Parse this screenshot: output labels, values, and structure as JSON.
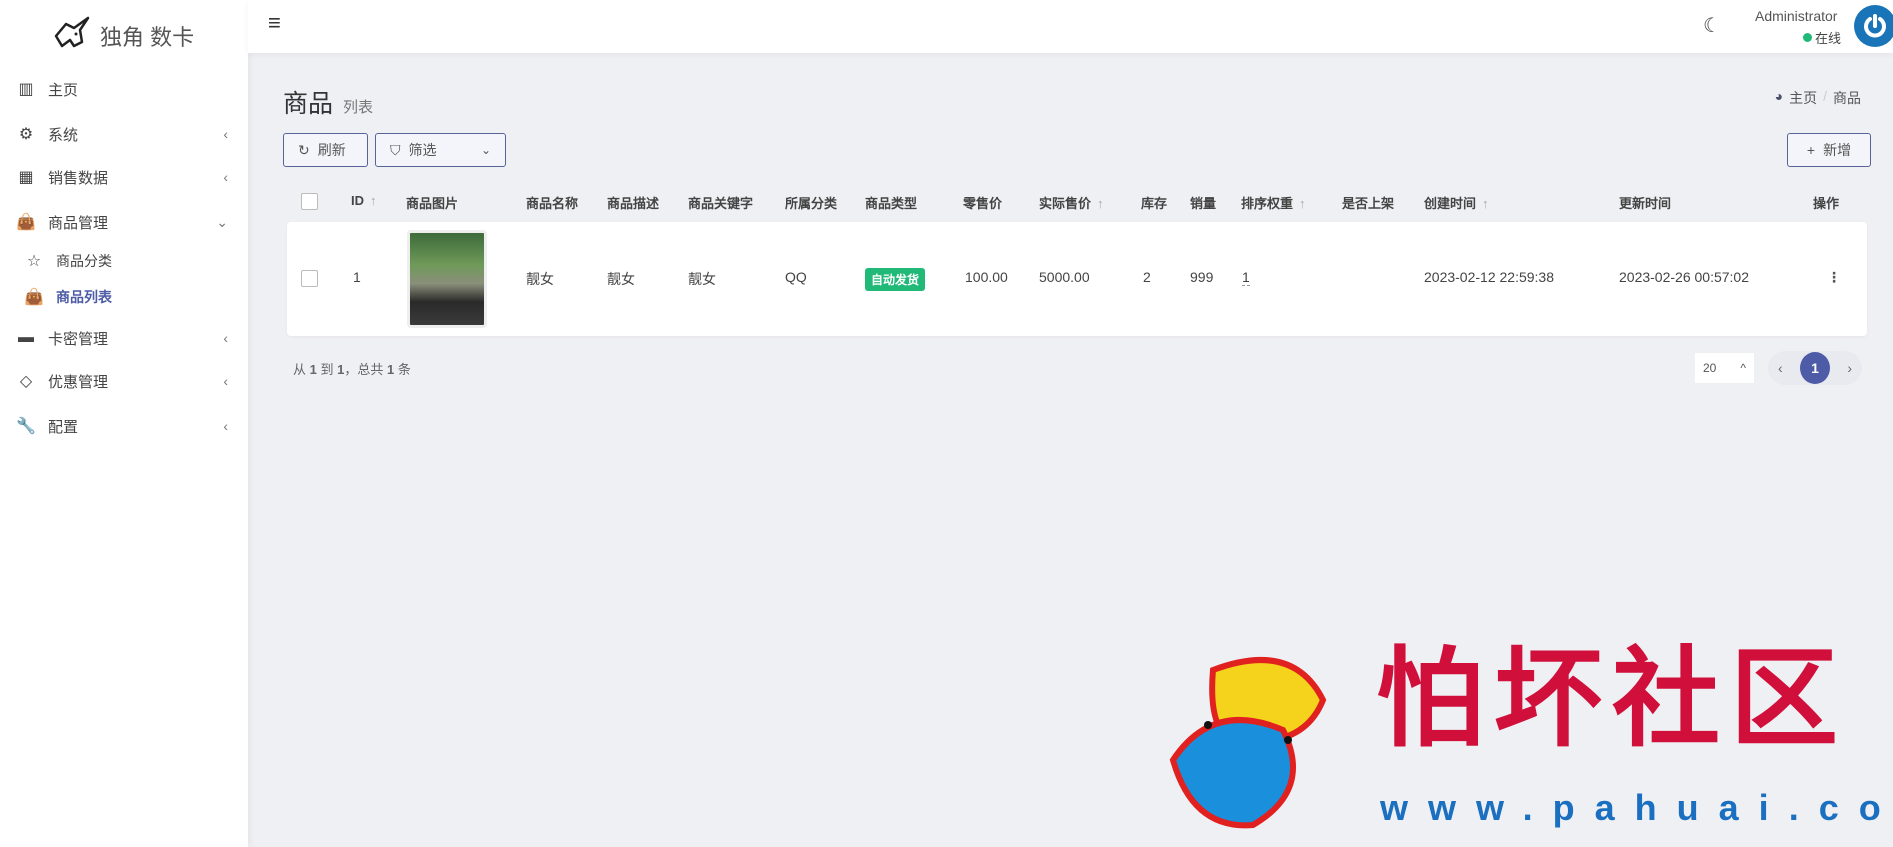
{
  "app": {
    "logo_text": "独角 数卡"
  },
  "sidebar": {
    "items": [
      {
        "label": "主页",
        "icon": "bar-chart-icon"
      },
      {
        "label": "系统",
        "icon": "gear-icon"
      },
      {
        "label": "销售数据",
        "icon": "table-icon"
      },
      {
        "label": "商品管理",
        "icon": "shopping-bag-icon"
      },
      {
        "label": "商品分类",
        "icon": "star-icon"
      },
      {
        "label": "商品列表",
        "icon": "shopping-bag-icon"
      },
      {
        "label": "卡密管理",
        "icon": "credit-card-icon"
      },
      {
        "label": "优惠管理",
        "icon": "diamond-icon"
      },
      {
        "label": "配置",
        "icon": "wrench-icon"
      }
    ]
  },
  "header": {
    "user_name": "Administrator",
    "status": "在线",
    "status_color": "#21b978"
  },
  "page": {
    "title": "商品",
    "subtitle": "列表",
    "breadcrumb": [
      "主页",
      "商品"
    ],
    "breadcrumb_sep": "/"
  },
  "toolbar": {
    "refresh": "刷新",
    "filter": "筛选",
    "add": "新增"
  },
  "table": {
    "headers": [
      "ID",
      "商品图片",
      "商品名称",
      "商品描述",
      "商品关键字",
      "所属分类",
      "商品类型",
      "零售价",
      "实际售价",
      "库存",
      "销量",
      "排序权重",
      "是否上架",
      "创建时间",
      "更新时间",
      "操作"
    ],
    "rows": [
      {
        "id": "1",
        "name": "靓女",
        "description": "靓女",
        "keywords": "靓女",
        "category": "QQ",
        "type": "自动发货",
        "retail_price": "100.00",
        "actual_price": "5000.00",
        "stock": "2",
        "sales": "999",
        "sort": "1",
        "on_shelf": true,
        "created": "2023-02-12 22:59:38",
        "updated": "2023-02-26 00:57:02"
      }
    ]
  },
  "pagination": {
    "summary_parts": [
      "从",
      "1",
      "到",
      "1",
      "，总共",
      "1",
      "条"
    ],
    "per_page": "20",
    "current": "1"
  },
  "watermark": {
    "title": "怕坏社区",
    "url": "www.pahuai.com"
  },
  "colors": {
    "accent": "#4e5ba6",
    "success": "#21b978",
    "watermark_red": "#d0103a",
    "watermark_blue": "#1a6fc0"
  }
}
